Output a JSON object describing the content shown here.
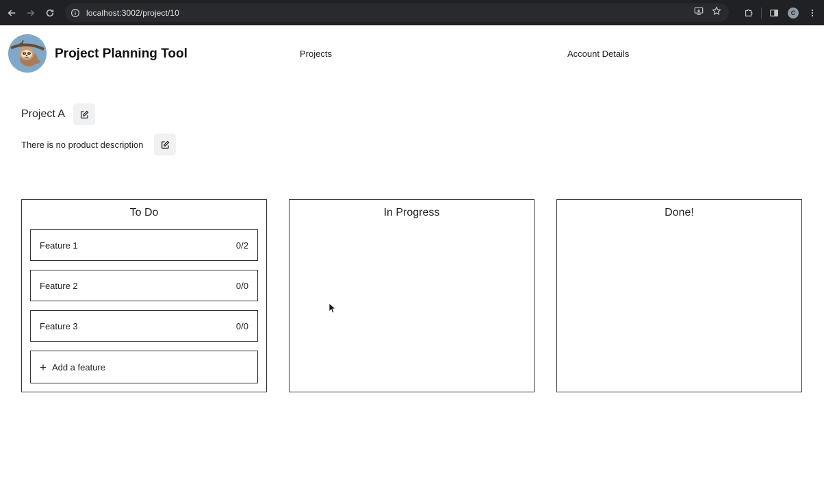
{
  "browser": {
    "url": "localhost:3002/project/10",
    "profile_initial": "C"
  },
  "header": {
    "title": "Project Planning Tool",
    "nav": {
      "projects": "Projects",
      "account": "Account Details"
    }
  },
  "project": {
    "name": "Project A",
    "description": "There is no product description"
  },
  "board": {
    "columns": [
      {
        "title": "To Do",
        "cards": [
          {
            "label": "Feature 1",
            "count": "0/2"
          },
          {
            "label": "Feature 2",
            "count": "0/0"
          },
          {
            "label": "Feature 3",
            "count": "0/0"
          }
        ],
        "add_label": "Add a feature"
      },
      {
        "title": "In Progress",
        "cards": []
      },
      {
        "title": "Done!",
        "cards": []
      }
    ]
  },
  "icons": {
    "back": "arrow-left-icon",
    "forward": "arrow-right-icon",
    "reload": "reload-icon",
    "site_info": "info-icon",
    "install": "install-app-icon",
    "bookmark": "star-icon",
    "extensions": "puzzle-icon",
    "sidebar": "side-panel-icon",
    "menu": "kebab-menu-icon",
    "edit": "edit-icon",
    "add": "plus-icon"
  },
  "colors": {
    "chrome_bg": "#202124",
    "omnibox_bg": "#282a2d",
    "edit_button_bg": "#f0f1f3",
    "logo_bg": "#7fa8c9"
  }
}
